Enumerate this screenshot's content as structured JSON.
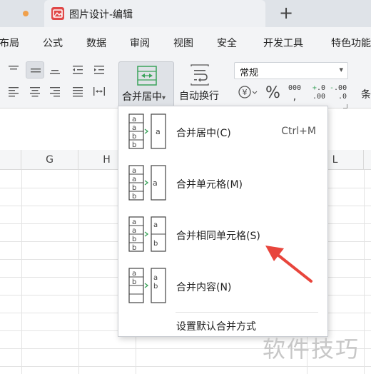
{
  "tabs": {
    "document_title": "图片设计-编辑",
    "new_tab_symbol": "+"
  },
  "menu": {
    "items": [
      "布局",
      "公式",
      "数据",
      "审阅",
      "视图",
      "安全",
      "开发工具",
      "特色功能"
    ]
  },
  "ribbon": {
    "merge_label": "合并居中",
    "merge_caret": "▾",
    "wrap_label": "自动换行",
    "number_format": "常规",
    "number_format_caret": "▾",
    "currency_symbol": "¥",
    "percent_symbol": "%",
    "thousands": "000",
    "thousands_sub": ",",
    "increase_decimal_top": ".0",
    "increase_decimal_bottom": ".00",
    "increase_decimal_sign": "+",
    "decrease_decimal_top": ".00",
    "decrease_decimal_bottom": ".0",
    "decrease_decimal_sign": "-",
    "conditional_partial": "条"
  },
  "grid": {
    "columns": [
      "G",
      "H",
      "L"
    ]
  },
  "dropdown": {
    "items": [
      {
        "label": "合并居中(C)",
        "shortcut": "Ctrl+M",
        "icon": "merge-center-icon"
      },
      {
        "label": "合并单元格(M)",
        "shortcut": "",
        "icon": "merge-cells-icon"
      },
      {
        "label": "合并相同单元格(S)",
        "shortcut": "",
        "icon": "merge-same-cells-icon"
      },
      {
        "label": "合并内容(N)",
        "shortcut": "",
        "icon": "merge-content-icon"
      }
    ],
    "footer": "设置默认合并方式",
    "icon_letters": {
      "a": "a",
      "b": "b"
    }
  },
  "watermark": "软件技巧",
  "colors": {
    "accent_green": "#3aa35a",
    "arrow_red": "#e8453c",
    "tab_icon_red": "#e04848",
    "tab_dot": "#f0a04b"
  }
}
